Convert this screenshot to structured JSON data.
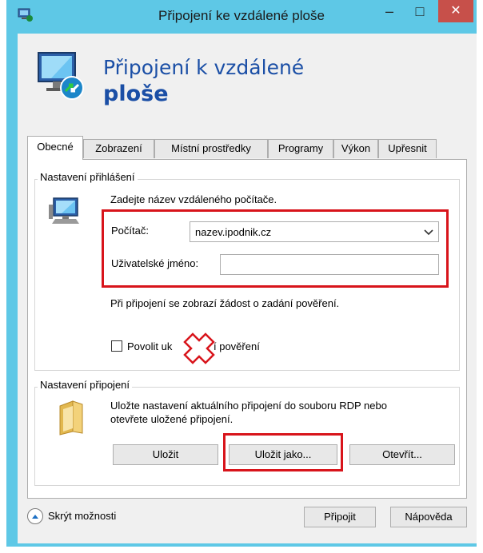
{
  "window": {
    "title": "Připojení ke vzdálené ploše",
    "minimize_glyph": "–",
    "maximize_glyph": "□",
    "close_glyph": "✕"
  },
  "header": {
    "line1": "Připojení k vzdálené",
    "line2": "ploše"
  },
  "tabs": [
    {
      "label": "Obecné",
      "active": true
    },
    {
      "label": "Zobrazení",
      "active": false
    },
    {
      "label": "Místní prostředky",
      "active": false
    },
    {
      "label": "Programy",
      "active": false
    },
    {
      "label": "Výkon",
      "active": false
    },
    {
      "label": "Upřesnit",
      "active": false
    }
  ],
  "login_settings": {
    "title": "Nastavení přihlášení",
    "instruction": "Zadejte název vzdáleného počítače.",
    "computer_label": "Počítač:",
    "computer_value": "nazev.ipodnik.cz",
    "username_label": "Uživatelské jméno:",
    "username_value": "",
    "credentials_note": "Při připojení se zobrazí žádost o zadání pověření.",
    "save_credentials_label": "Povolit uk",
    "save_credentials_label_end": "í pověření",
    "save_credentials_checked": false
  },
  "connection_settings": {
    "title": "Nastavení připojení",
    "description_line1": "Uložte nastavení aktuálního připojení do souboru RDP nebo",
    "description_line2": "otevřete uložené připojení.",
    "save_button": "Uložit",
    "save_as_button": "Uložit jako...",
    "open_button": "Otevřít..."
  },
  "footer": {
    "hide_options": "Skrýt možnosti",
    "connect_button": "Připojit",
    "help_button": "Nápověda"
  },
  "colors": {
    "accent_frame": "#5ec8e6",
    "header_text": "#1b4fa6",
    "highlight_red": "#d8141b",
    "close_button": "#c7504a"
  }
}
